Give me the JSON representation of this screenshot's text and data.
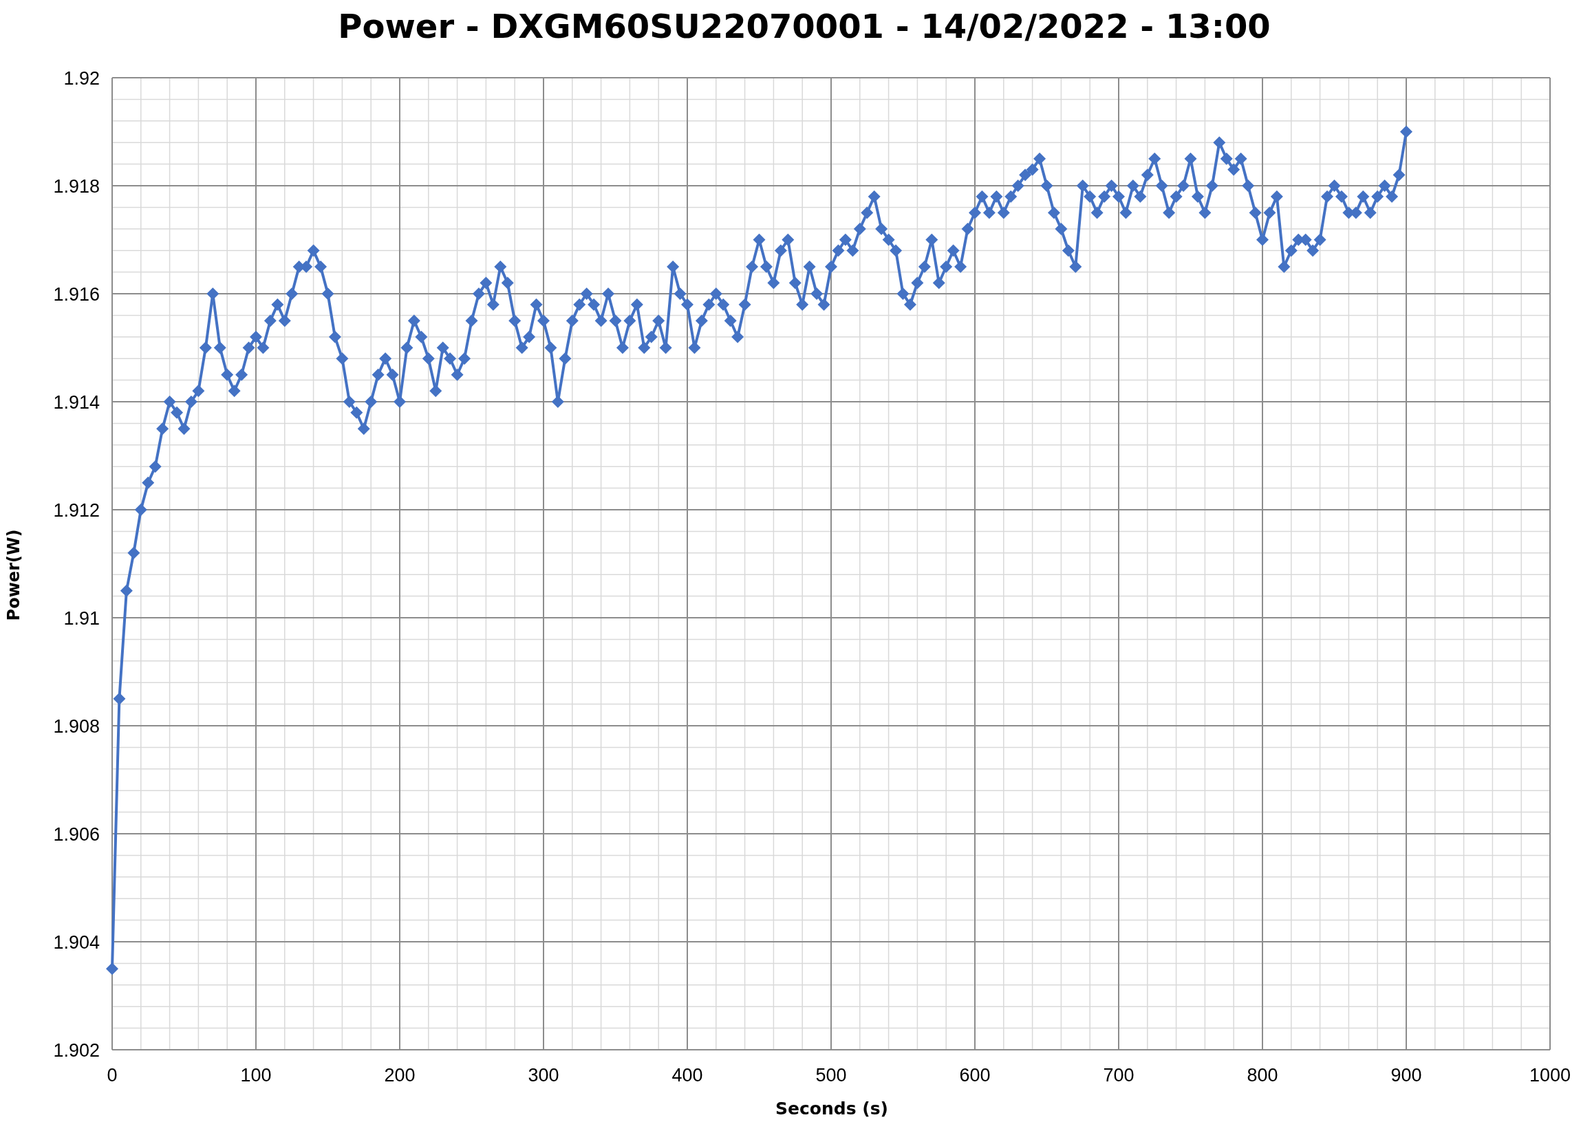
{
  "chart_data": {
    "type": "line",
    "title": "Power - DXGM60SU22070001 - 14/02/2022 - 13:00",
    "xlabel": "Seconds (s)",
    "ylabel": "Power(W)",
    "x": [
      0,
      5,
      10,
      15,
      20,
      25,
      30,
      35,
      40,
      45,
      50,
      55,
      60,
      65,
      70,
      75,
      80,
      85,
      90,
      95,
      100,
      105,
      110,
      115,
      120,
      125,
      130,
      135,
      140,
      145,
      150,
      155,
      160,
      165,
      170,
      175,
      180,
      185,
      190,
      195,
      200,
      205,
      210,
      215,
      220,
      225,
      230,
      235,
      240,
      245,
      250,
      255,
      260,
      265,
      270,
      275,
      280,
      285,
      290,
      295,
      300,
      305,
      310,
      315,
      320,
      325,
      330,
      335,
      340,
      345,
      350,
      355,
      360,
      365,
      370,
      375,
      380,
      385,
      390,
      395,
      400,
      405,
      410,
      415,
      420,
      425,
      430,
      435,
      440,
      445,
      450,
      455,
      460,
      465,
      470,
      475,
      480,
      485,
      490,
      495,
      500,
      505,
      510,
      515,
      520,
      525,
      530,
      535,
      540,
      545,
      550,
      555,
      560,
      565,
      570,
      575,
      580,
      585,
      590,
      595,
      600,
      605,
      610,
      615,
      620,
      625,
      630,
      635,
      640,
      645,
      650,
      655,
      660,
      665,
      670,
      675,
      680,
      685,
      690,
      695,
      700,
      705,
      710,
      715,
      720,
      725,
      730,
      735,
      740,
      745,
      750,
      755,
      760,
      765,
      770,
      775,
      780,
      785,
      790,
      795,
      800,
      805,
      810,
      815,
      820,
      825,
      830,
      835,
      840,
      845,
      850,
      855,
      860,
      865,
      870,
      875,
      880,
      885,
      890,
      895,
      900
    ],
    "series": [
      {
        "color": "#4472c4",
        "marker": "diamond",
        "values": [
          1.9035,
          1.9085,
          1.9105,
          1.9112,
          1.912,
          1.9125,
          1.9128,
          1.9135,
          1.914,
          1.9138,
          1.9135,
          1.914,
          1.9142,
          1.915,
          1.916,
          1.915,
          1.9145,
          1.9142,
          1.9145,
          1.915,
          1.9152,
          1.915,
          1.9155,
          1.9158,
          1.9155,
          1.916,
          1.9165,
          1.9165,
          1.9168,
          1.9165,
          1.916,
          1.9152,
          1.9148,
          1.914,
          1.9138,
          1.9135,
          1.914,
          1.9145,
          1.9148,
          1.9145,
          1.914,
          1.915,
          1.9155,
          1.9152,
          1.9148,
          1.9142,
          1.915,
          1.9148,
          1.9145,
          1.9148,
          1.9155,
          1.916,
          1.9162,
          1.9158,
          1.9165,
          1.9162,
          1.9155,
          1.915,
          1.9152,
          1.9158,
          1.9155,
          1.915,
          1.914,
          1.9148,
          1.9155,
          1.9158,
          1.916,
          1.9158,
          1.9155,
          1.916,
          1.9155,
          1.915,
          1.9155,
          1.9158,
          1.915,
          1.9152,
          1.9155,
          1.915,
          1.9165,
          1.916,
          1.9158,
          1.915,
          1.9155,
          1.9158,
          1.916,
          1.9158,
          1.9155,
          1.9152,
          1.9158,
          1.9165,
          1.917,
          1.9165,
          1.9162,
          1.9168,
          1.917,
          1.9162,
          1.9158,
          1.9165,
          1.916,
          1.9158,
          1.9165,
          1.9168,
          1.917,
          1.9168,
          1.9172,
          1.9175,
          1.9178,
          1.9172,
          1.917,
          1.9168,
          1.916,
          1.9158,
          1.9162,
          1.9165,
          1.917,
          1.9162,
          1.9165,
          1.9168,
          1.9165,
          1.9172,
          1.9175,
          1.9178,
          1.9175,
          1.9178,
          1.9175,
          1.9178,
          1.918,
          1.9182,
          1.9183,
          1.9185,
          1.918,
          1.9175,
          1.9172,
          1.9168,
          1.9165,
          1.918,
          1.9178,
          1.9175,
          1.9178,
          1.918,
          1.9178,
          1.9175,
          1.918,
          1.9178,
          1.9182,
          1.9185,
          1.918,
          1.9175,
          1.9178,
          1.918,
          1.9185,
          1.9178,
          1.9175,
          1.918,
          1.9188,
          1.9185,
          1.9183,
          1.9185,
          1.918,
          1.9175,
          1.917,
          1.9175,
          1.9178,
          1.9165,
          1.9168,
          1.917,
          1.917,
          1.9168,
          1.917,
          1.9178,
          1.918,
          1.9178,
          1.9175,
          1.9175,
          1.9178,
          1.9175,
          1.9178,
          1.918,
          1.9178,
          1.9182,
          1.919
        ]
      }
    ],
    "grid": true,
    "xlim": [
      0,
      1000
    ],
    "ylim": [
      1.902,
      1.92
    ],
    "xticks": [
      0,
      100,
      200,
      300,
      400,
      500,
      600,
      700,
      800,
      900,
      1000
    ],
    "yticks": [
      {
        "value": 1.902,
        "label": "1.902"
      },
      {
        "value": 1.904,
        "label": "1.904"
      },
      {
        "value": 1.906,
        "label": "1.906"
      },
      {
        "value": 1.908,
        "label": "1.908"
      },
      {
        "value": 1.91,
        "label": "1.91"
      },
      {
        "value": 1.912,
        "label": "1.912"
      },
      {
        "value": 1.914,
        "label": "1.914"
      },
      {
        "value": 1.916,
        "label": "1.916"
      },
      {
        "value": 1.918,
        "label": "1.918"
      },
      {
        "value": 1.92,
        "label": "1.92"
      }
    ]
  }
}
